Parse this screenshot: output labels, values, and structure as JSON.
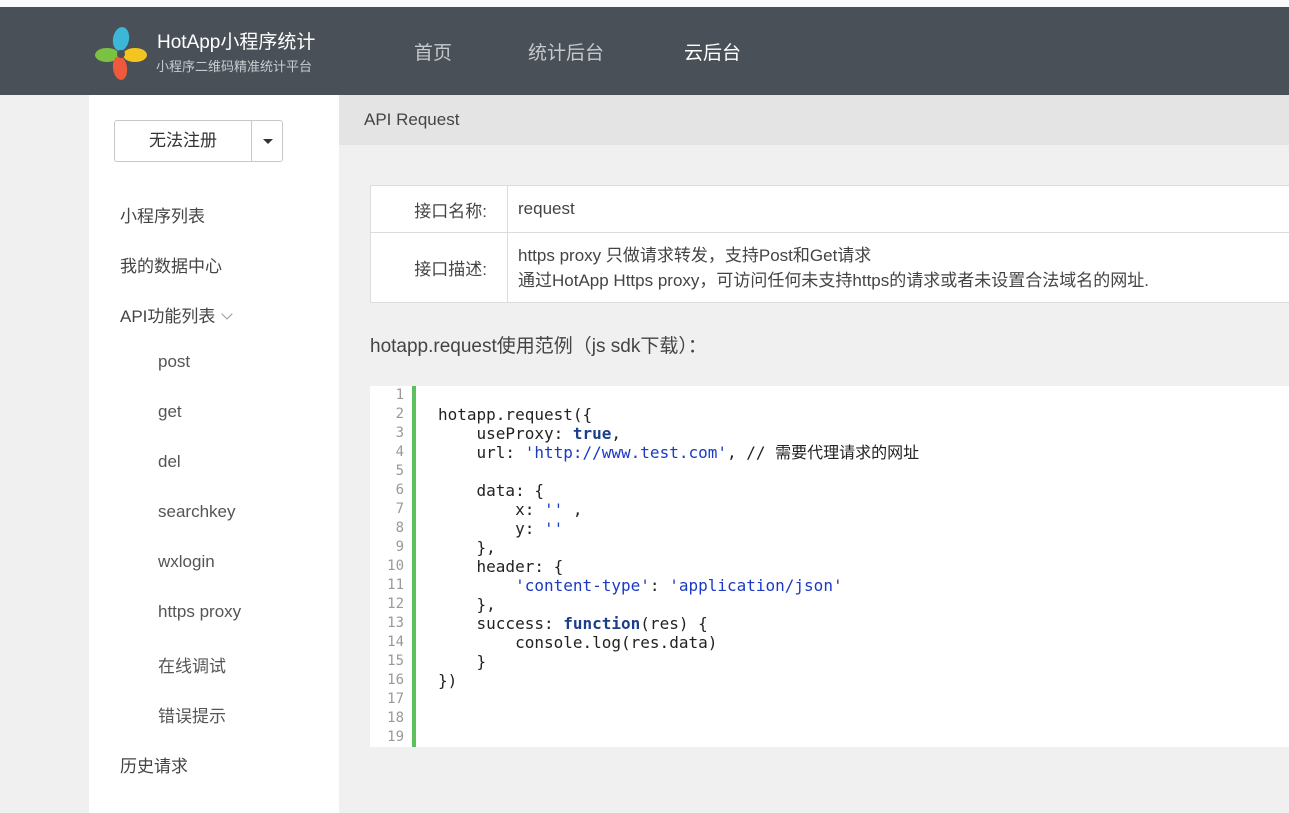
{
  "brand": {
    "title": "HotApp小程序统计",
    "subtitle": "小程序二维码精准统计平台"
  },
  "nav": [
    {
      "label": "首页",
      "active": false
    },
    {
      "label": "统计后台",
      "active": false
    },
    {
      "label": "云后台",
      "active": true
    }
  ],
  "sidebar": {
    "app_select": {
      "label": "无法注册"
    },
    "items": [
      {
        "label": "小程序列表"
      },
      {
        "label": "我的数据中心"
      },
      {
        "label": "API功能列表"
      },
      {
        "label": "post"
      },
      {
        "label": "get"
      },
      {
        "label": "del"
      },
      {
        "label": "searchkey"
      },
      {
        "label": "wxlogin"
      },
      {
        "label": "https proxy"
      },
      {
        "label": "在线调试"
      },
      {
        "label": "错误提示"
      },
      {
        "label": "历史请求"
      }
    ]
  },
  "main": {
    "breadcrumb": "API Request",
    "info": {
      "name_key": "接口名称:",
      "name_value": "request",
      "desc_key": "接口描述:",
      "desc_line1": "https proxy 只做请求转发，支持Post和Get请求",
      "desc_line2": "通过HotApp Https proxy，可访问任何未支持https的请求或者未设置合法域名的网址."
    },
    "example_title": "hotapp.request使用范例（js sdk下载）：",
    "code": {
      "line_numbers": [
        "1",
        "2",
        "3",
        "4",
        "5",
        "6",
        "7",
        "8",
        "9",
        "10",
        "11",
        "12",
        "13",
        "14",
        "15",
        "16",
        "17",
        "18",
        "19"
      ],
      "l2": "hotapp.request({",
      "l3_key": "    useProxy: ",
      "l3_val": "true",
      "l3_end": ",",
      "l4_key": "    url: ",
      "l4_val": "'http://www.test.com'",
      "l4_end": ", // 需要代理请求的网址",
      "l6": "    data: {",
      "l7_key": "        x: ",
      "l7_val": "''",
      "l7_end": " ,",
      "l8_key": "        y: ",
      "l8_val": "''",
      "l9": "    },",
      "l10": "    header: {",
      "l11_pre": "        ",
      "l11_key": "'content-type'",
      "l11_mid": ": ",
      "l11_val": "'application/json'",
      "l12": "    },",
      "l13_key": "    success: ",
      "l13_kw": "function",
      "l13_end": "(res) {",
      "l14": "        console.log(res.data)",
      "l15": "    }",
      "l16": "})"
    }
  },
  "colors": {
    "header_bg": "#4a5057",
    "accent_green": "#5cc05c",
    "keyword": "#1b3f8a",
    "string": "#1a39c4"
  }
}
